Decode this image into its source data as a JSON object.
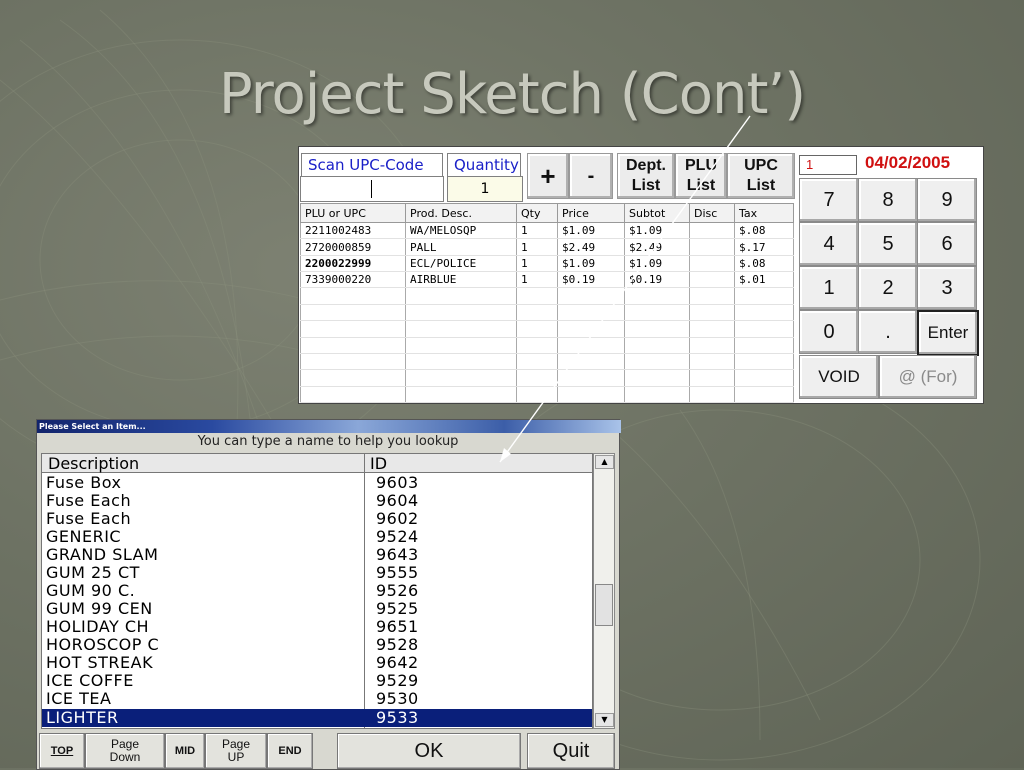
{
  "slide": {
    "title": "Project Sketch (Cont’)"
  },
  "pos": {
    "scan_label": "Scan UPC-Code",
    "quantity_label": "Quantity",
    "quantity_value": "1",
    "plus": "+",
    "minus": "-",
    "dept_list": [
      "Dept.",
      "List"
    ],
    "plu_list": [
      "PLU",
      "List"
    ],
    "upc_list": [
      "UPC",
      "List"
    ],
    "counter": "1",
    "date": "04/02/2005",
    "columns": [
      "PLU or UPC",
      "Prod. Desc.",
      "Qty",
      "Price",
      "Subtot",
      "Disc",
      "Tax"
    ],
    "rows": [
      {
        "upc": "2211002483",
        "desc": "WA/MELOSQP",
        "qty": "1",
        "price": "$1.09",
        "subtot": "$1.09",
        "disc": "",
        "tax": "$.08"
      },
      {
        "upc": "2720000859",
        "desc": "PALL",
        "qty": "1",
        "price": "$2.49",
        "subtot": "$2.49",
        "disc": "",
        "tax": "$.17"
      },
      {
        "upc": "2200022999",
        "desc": "ECL/POLICE",
        "qty": "1",
        "price": "$1.09",
        "subtot": "$1.09",
        "disc": "",
        "tax": "$.08"
      },
      {
        "upc": "7339000220",
        "desc": "AIRBLUE",
        "qty": "1",
        "price": "$0.19",
        "subtot": "$0.19",
        "disc": "",
        "tax": "$.01"
      }
    ],
    "keypad": {
      "k7": "7",
      "k8": "8",
      "k9": "9",
      "k4": "4",
      "k5": "5",
      "k6": "6",
      "k1": "1",
      "k2": "2",
      "k3": "3",
      "k0": "0",
      "dot": ".",
      "enter": "Enter",
      "void": "VOID",
      "at_for": "@ (For)"
    }
  },
  "dialog": {
    "title": "Please Select an Item...",
    "hint": "You can type a name to help you lookup",
    "col_description": "Description",
    "col_id": "ID",
    "items": [
      {
        "desc": "Fuse Box",
        "id": "9603"
      },
      {
        "desc": "Fuse Each",
        "id": "9604"
      },
      {
        "desc": "Fuse Each",
        "id": "9602"
      },
      {
        "desc": "GENERIC",
        "id": "9524"
      },
      {
        "desc": "GRAND SLAM",
        "id": "9643"
      },
      {
        "desc": "GUM 25 CT",
        "id": "9555"
      },
      {
        "desc": "GUM 90 C.",
        "id": "9526"
      },
      {
        "desc": "GUM 99 CEN",
        "id": "9525"
      },
      {
        "desc": "HOLIDAY CH",
        "id": "9651"
      },
      {
        "desc": "HOROSCOP C",
        "id": "9528"
      },
      {
        "desc": "HOT STREAK",
        "id": "9642"
      },
      {
        "desc": "ICE COFFE",
        "id": "9529"
      },
      {
        "desc": "ICE TEA",
        "id": "9530"
      },
      {
        "desc": "LIGHTER",
        "id": "9533"
      }
    ],
    "selected_index": 13,
    "buttons": {
      "top": "TOP",
      "page_down": [
        "Page",
        "Down"
      ],
      "mid": "MID",
      "page_up": [
        "Page",
        "UP"
      ],
      "end": "END",
      "ok": "OK",
      "quit": "Quit"
    }
  },
  "colors": {
    "label_blue": "#1a20c8",
    "date_red": "#d01010",
    "selection": "#0a1f7a"
  }
}
